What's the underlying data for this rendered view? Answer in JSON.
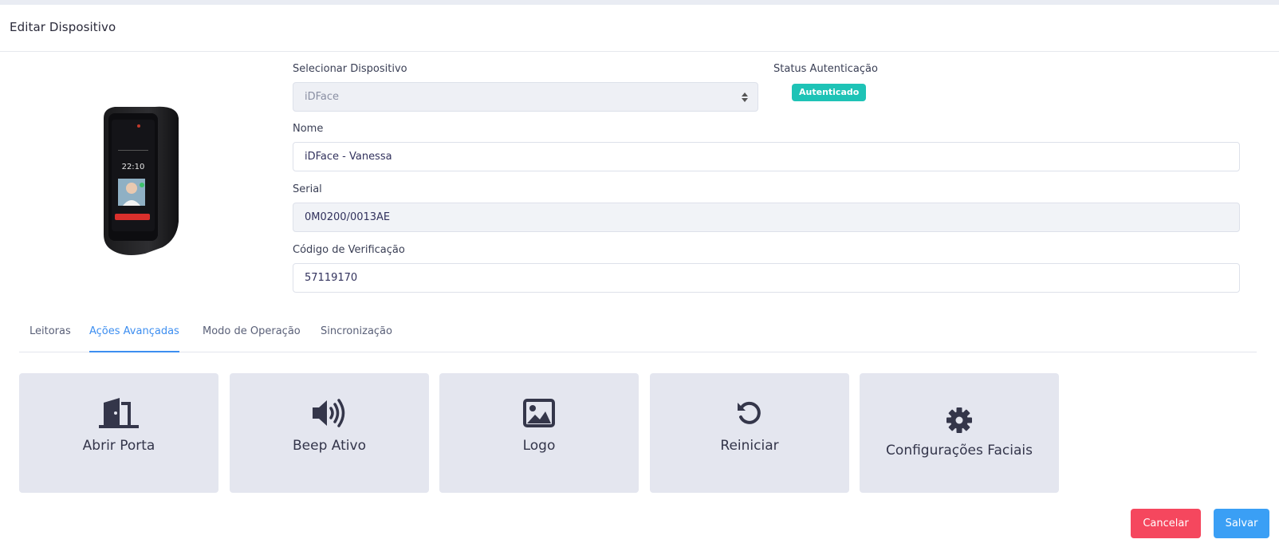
{
  "header": {
    "title": "Editar Dispositivo"
  },
  "device": {
    "image_icon": "idface-device-image",
    "screen_time": "22:10"
  },
  "form": {
    "select_device": {
      "label": "Selecionar Dispositivo",
      "value": "iDFace"
    },
    "status": {
      "label": "Status Autenticação",
      "badge": "Autenticado",
      "badge_color": "#1ec3b6"
    },
    "name": {
      "label": "Nome",
      "value": "iDFace - Vanessa"
    },
    "serial": {
      "label": "Serial",
      "value": "0M0200/0013AE"
    },
    "verification_code": {
      "label": "Código de Verificação",
      "value": "57119170"
    }
  },
  "tabs": [
    {
      "label": "Leitoras",
      "active": false
    },
    {
      "label": "Ações Avançadas",
      "active": true
    },
    {
      "label": "Modo de Operação",
      "active": false
    },
    {
      "label": "Sincronização",
      "active": false
    }
  ],
  "actions": [
    {
      "label": "Abrir Porta",
      "icon": "door-open-icon"
    },
    {
      "label": "Beep Ativo",
      "icon": "volume-up-icon"
    },
    {
      "label": "Logo",
      "icon": "image-icon"
    },
    {
      "label": "Reiniciar",
      "icon": "restart-icon"
    },
    {
      "label": "Configurações Faciais",
      "icon": "gear-icon"
    }
  ],
  "footer": {
    "cancel_label": "Cancelar",
    "save_label": "Salvar"
  },
  "colors": {
    "accent": "#3d8ef0",
    "danger": "#f5475e",
    "primary": "#3a9ff5",
    "action_bg": "#e4e6ef"
  }
}
